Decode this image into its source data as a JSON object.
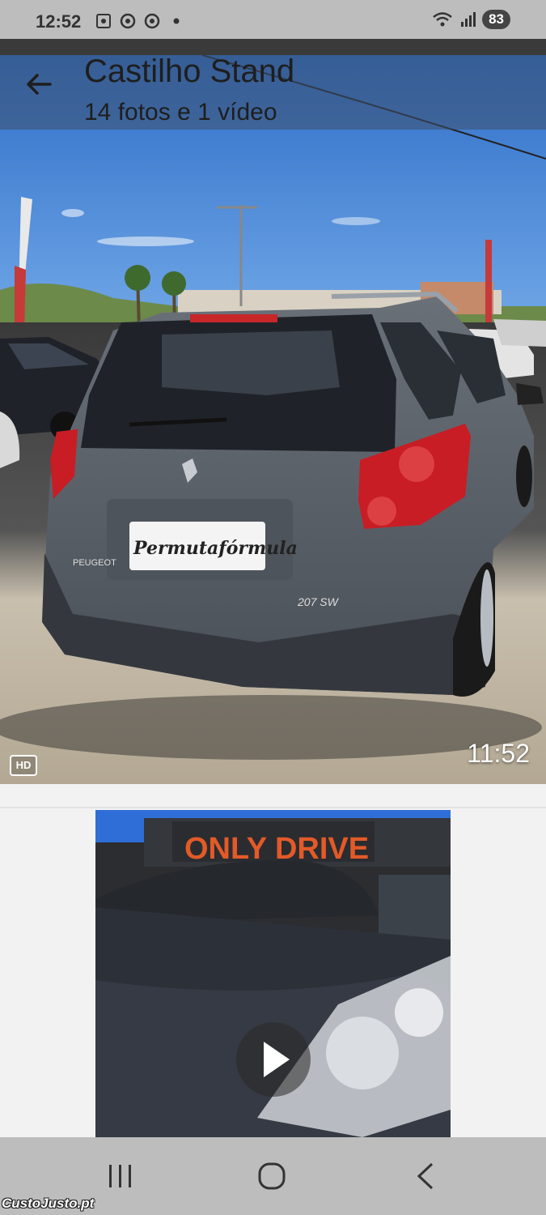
{
  "status_bar": {
    "time": "12:52",
    "battery": "83",
    "icons": [
      "screenshot-icon",
      "chrome-icon",
      "chrome-icon",
      "dot-icon",
      "wifi-icon",
      "signal-icon"
    ]
  },
  "header": {
    "title": "Castilho Stand",
    "subtitle": "14 fotos e 1 vídeo",
    "back_icon": "arrow-left-icon"
  },
  "media": [
    {
      "type": "video",
      "badge": "HD",
      "duration": "11:52",
      "plate_text": "Permutafórmula",
      "brand_text": "PEUGEOT",
      "model_text": "207 SW"
    },
    {
      "type": "video",
      "sign_text": "ONLY DRIVE",
      "play_icon": "play-icon"
    }
  ],
  "nav_bar": {
    "icons": [
      "recent-apps-icon",
      "home-icon",
      "back-icon"
    ]
  },
  "watermark": "CustoJusto.pt",
  "colors": {
    "status_bar_bg": "#bdbdbd",
    "sky": "#3f7fd6",
    "car_body": "#5a6068"
  }
}
